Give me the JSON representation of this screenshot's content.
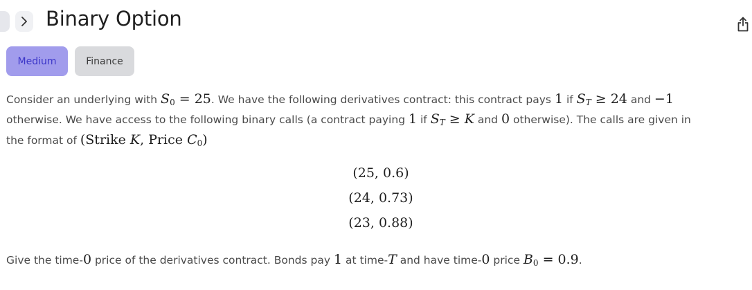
{
  "header": {
    "title": "Binary Option",
    "chevron_glyph": ">"
  },
  "tags": [
    {
      "label": "Medium"
    },
    {
      "label": "Finance"
    }
  ],
  "problem": {
    "line1": {
      "a": "Consider an underlying with ",
      "b": "S",
      "b_sub": "0",
      "c": " = 25",
      "d": ". We have the following derivatives contract: this contract pays ",
      "e": "1",
      "f": " if ",
      "g": "S",
      "g_sub": "T",
      "h": " ≥ 24",
      "i": " and ",
      "j": "−1"
    },
    "line2": {
      "a": "otherwise. We have access to the following binary calls (a contract paying ",
      "b": "1",
      "c": " if ",
      "d": "S",
      "d_sub": "T",
      "e": " ≥ ",
      "f": "K",
      "g": " and ",
      "h": "0",
      "i": " otherwise). The calls are given in"
    },
    "line3": {
      "a": "the format of ",
      "b": "(Strike ",
      "c": "K",
      "d": ", Price ",
      "e": "C",
      "e_sub": "0",
      "f": ")"
    },
    "pairs": [
      "(25, 0.6)",
      "(24, 0.73)",
      "(23, 0.88)"
    ],
    "line4": {
      "a": "Give the time-",
      "b": "0",
      "c": " price of the derivatives contract. Bonds pay ",
      "d": "1",
      "e": " at time-",
      "f": "T",
      "g": " and have time-",
      "h": "0",
      "i": " price ",
      "j": "B",
      "j_sub": "0",
      "k": " = 0.9",
      "l": "."
    }
  },
  "icons": {
    "back": "back-button-icon",
    "chevron": "chevron-right-icon",
    "share": "share-icon"
  },
  "colors": {
    "medium_tag_bg": "#a19cec",
    "medium_tag_text": "#3c36c9",
    "finance_tag_bg": "#d9dadd"
  }
}
